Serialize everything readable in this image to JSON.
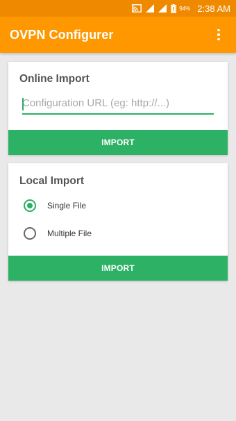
{
  "status_bar": {
    "battery_percent": "94%",
    "time": "2:38 AM",
    "icons": [
      "cast-icon",
      "signal-icon",
      "signal-icon",
      "battery-icon"
    ]
  },
  "app_bar": {
    "title": "OVPN Configurer",
    "menu_icon": "overflow-menu-icon"
  },
  "online_import": {
    "title": "Online Import",
    "url_value": "",
    "url_placeholder": "Configuration URL (eg: http://...)",
    "button_label": "IMPORT"
  },
  "local_import": {
    "title": "Local Import",
    "options": [
      {
        "label": "Single File",
        "selected": true
      },
      {
        "label": "Multiple File",
        "selected": false
      }
    ],
    "button_label": "IMPORT"
  },
  "colors": {
    "status_bar": "#ef8a00",
    "app_bar": "#ff9800",
    "accent": "#2db164",
    "background": "#e9e9e9"
  }
}
